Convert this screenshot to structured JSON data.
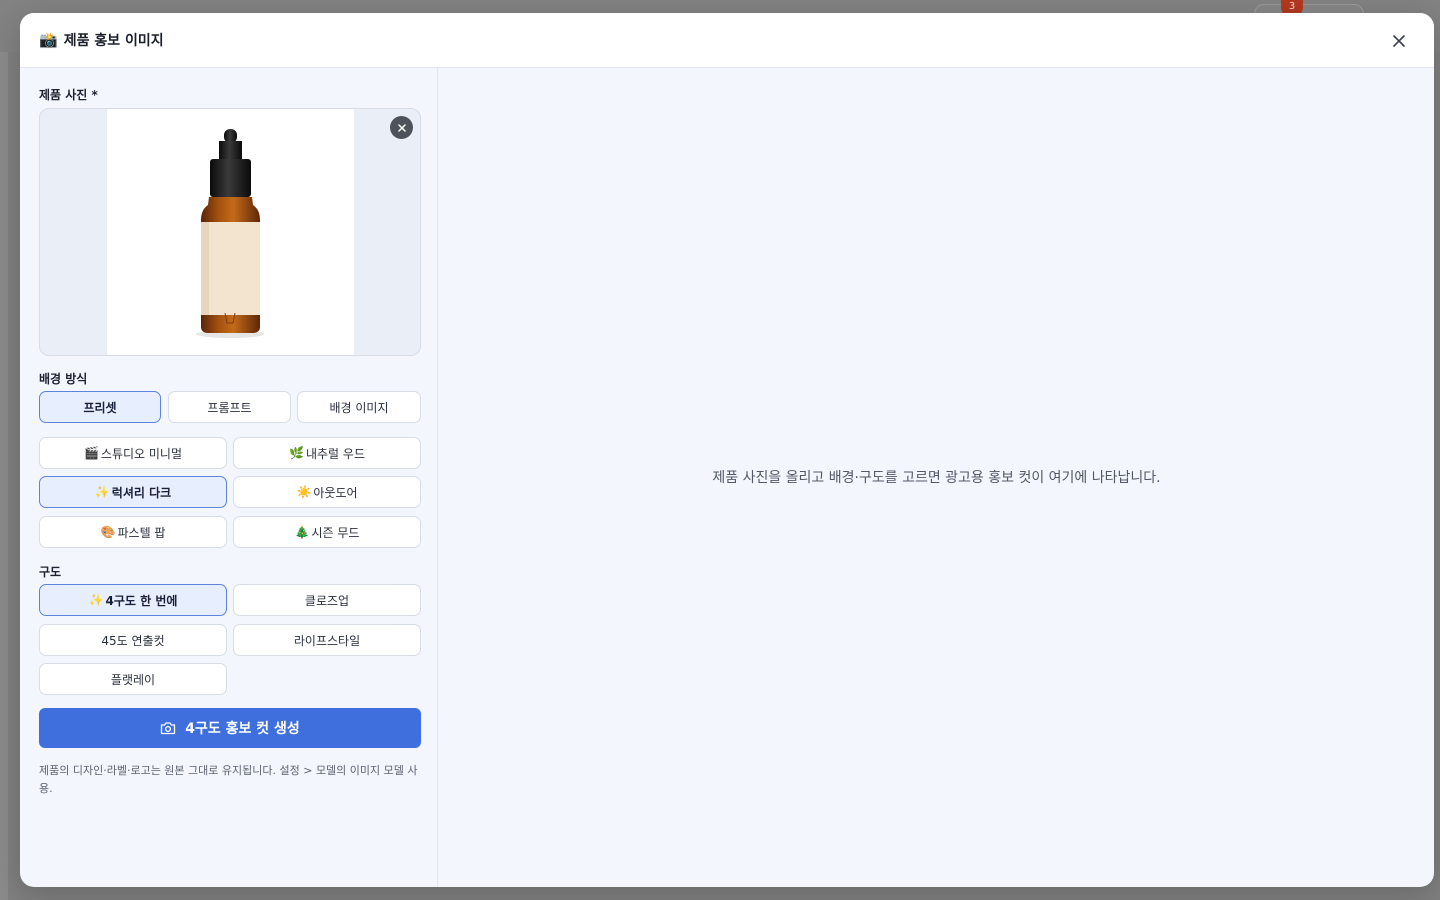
{
  "backdrop": {
    "badge_count": "3"
  },
  "modal": {
    "title": "제품 홍보 이미지",
    "title_emoji": "📸"
  },
  "photo": {
    "label": "제품 사진 *"
  },
  "background_mode": {
    "label": "배경 방식",
    "options": [
      "프리셋",
      "프롬프트",
      "배경 이미지"
    ],
    "selected": "프리셋"
  },
  "presets": [
    {
      "emoji": "🎬",
      "label": "스튜디오 미니멀"
    },
    {
      "emoji": "🌿",
      "label": "내추럴 우드"
    },
    {
      "emoji": "✨",
      "label": "럭셔리 다크"
    },
    {
      "emoji": "☀️",
      "label": "아웃도어"
    },
    {
      "emoji": "🎨",
      "label": "파스텔 팝"
    },
    {
      "emoji": "🎄",
      "label": "시즌 무드"
    }
  ],
  "selected_preset": "럭셔리 다크",
  "composition": {
    "label": "구도",
    "options": [
      {
        "emoji": "✨",
        "label": "4구도 한 번에"
      },
      {
        "emoji": "",
        "label": "클로즈업"
      },
      {
        "emoji": "",
        "label": "45도 연출컷"
      },
      {
        "emoji": "",
        "label": "라이프스타일"
      },
      {
        "emoji": "",
        "label": "플랫레이"
      }
    ],
    "selected": "4구도 한 번에"
  },
  "generate_button": "4구도 홍보 컷 생성",
  "footnote": "제품의 디자인·라벨·로고는 원본 그대로 유지됩니다. 설정 > 모델의 이미지 모델 사용.",
  "preview": {
    "empty_message": "제품 사진을 올리고 배경·구도를 고르면 광고용 홍보 컷이 여기에 나타납니다."
  }
}
